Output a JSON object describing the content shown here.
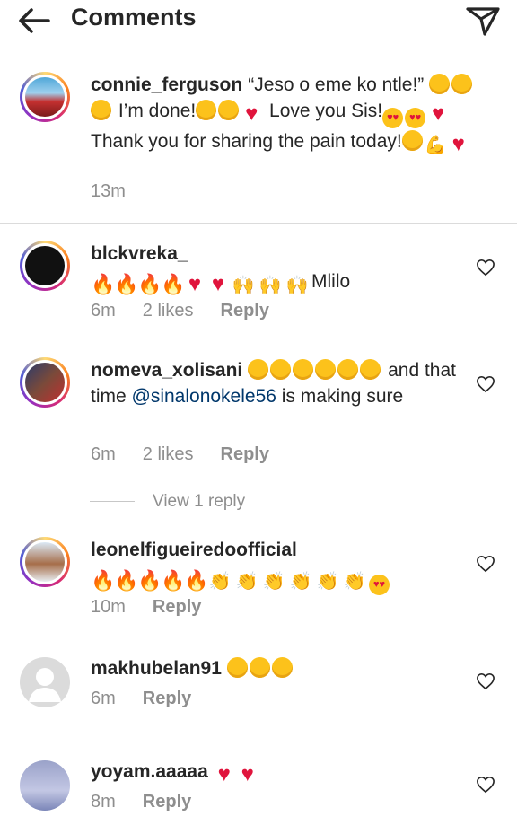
{
  "header": {
    "title": "Comments",
    "back_icon": "back-arrow-icon",
    "send_icon": "send-icon"
  },
  "comments": [
    {
      "username": "connie_ferguson",
      "text_parts": [
        "“Jeso o eme ko ntle!” ",
        " I’m done!",
        " Love you Sis!",
        " Thank you for sharing the pain today!"
      ],
      "time": "13m"
    },
    {
      "username": "blckvreka_",
      "text_parts": [
        "Mlilo"
      ],
      "time": "6m",
      "likes": "2 likes",
      "reply": "Reply"
    },
    {
      "username": "nomeva_xolisani",
      "text_parts": [
        " and that time ",
        "@sinalonokele56",
        " is making sure"
      ],
      "time": "6m",
      "likes": "2 likes",
      "reply": "Reply"
    },
    {
      "username": "leonelfigueiredoofficial",
      "time": "10m",
      "reply": "Reply"
    },
    {
      "username": "makhubelan91",
      "time": "6m",
      "reply": "Reply"
    },
    {
      "username": "yoyam.aaaaa",
      "time": "8m",
      "reply": "Reply"
    }
  ],
  "view_reply": "View 1 reply",
  "colors": {
    "mention": "#00376b",
    "muted": "#8e8e8e",
    "text": "#262626",
    "heart_emoji": "#e0143c"
  }
}
